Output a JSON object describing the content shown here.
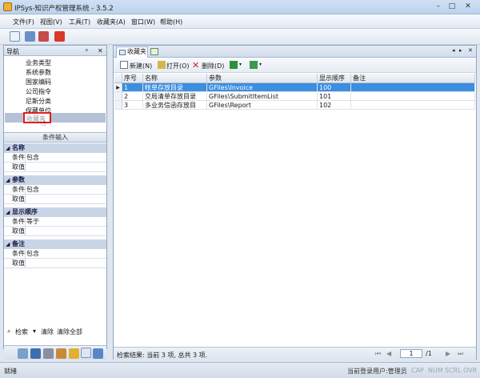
{
  "window": {
    "title": "IPSys-知识产权管理系统 - 3.5.2"
  },
  "menu": {
    "items": [
      "文件(F)",
      "视图(V)",
      "工具(T)",
      "收藏夹(A)",
      "窗口(W)",
      "帮助(H)"
    ]
  },
  "nav": {
    "title": "导航",
    "items": [
      "业务类型",
      "系统参数",
      "国家编码",
      "公司指令",
      "尼斯分类",
      "保藏单位",
      "收藏夹"
    ],
    "condition_title": "条件输入",
    "groups": [
      {
        "name": "名称",
        "rows": [
          {
            "k": "条件",
            "v": "包含"
          },
          {
            "k": "取值",
            "v": ""
          }
        ]
      },
      {
        "name": "参数",
        "rows": [
          {
            "k": "条件",
            "v": "包含"
          },
          {
            "k": "取值",
            "v": ""
          }
        ]
      },
      {
        "name": "显示顺序",
        "rows": [
          {
            "k": "条件",
            "v": "等于"
          },
          {
            "k": "取值",
            "v": ""
          }
        ]
      },
      {
        "name": "备注",
        "rows": [
          {
            "k": "条件",
            "v": "包含"
          },
          {
            "k": "取值",
            "v": ""
          }
        ]
      }
    ],
    "search_btn": "检索",
    "clear_btn": "清除",
    "clear_all_btn": "清除全部"
  },
  "doc": {
    "tab_label": "收藏夹",
    "toolbar": {
      "new": "新建(N)",
      "open": "打开(O)",
      "delete": "删除(D)"
    },
    "columns": [
      "序号",
      "名称",
      "参数",
      "显示顺序",
      "备注"
    ],
    "rows": [
      [
        "1",
        "帐单存放目录",
        "GFiles\\Invoice",
        "100",
        ""
      ],
      [
        "2",
        "交局清单存放目录",
        "GFiles\\SubmitItemList",
        "101",
        ""
      ],
      [
        "3",
        "多业务信函存放目",
        "GFiles\\Report",
        "102",
        ""
      ]
    ],
    "footer_status": "检索结果: 当前 3 项, 总共 3 项.",
    "page_current": "1",
    "page_total": "/1"
  },
  "status": {
    "left": "就绪",
    "user": "当前登录用户:管理员",
    "keys": [
      "CAP",
      "NUM",
      "SCRL",
      "OVR"
    ]
  },
  "colors": {
    "selected_row": "#3b8ee0",
    "highlight_border": "#e02020"
  }
}
